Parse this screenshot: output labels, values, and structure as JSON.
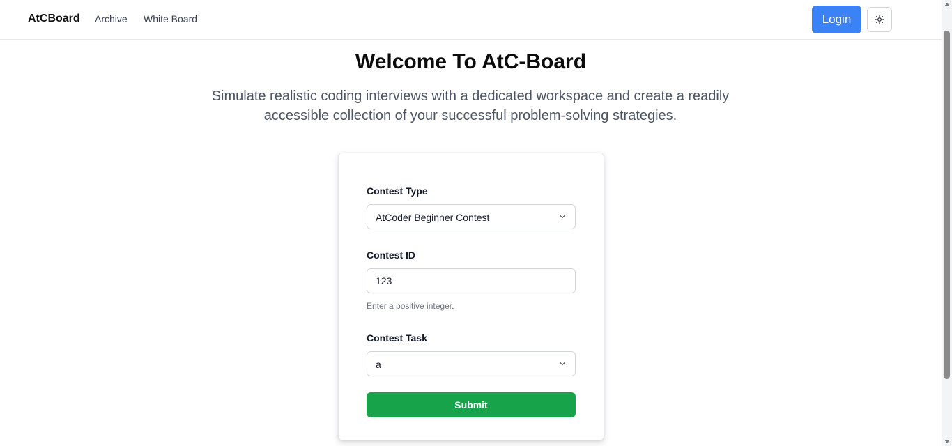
{
  "nav": {
    "brand": "AtCBoard",
    "links": [
      "Archive",
      "White Board"
    ],
    "login_label": "Login",
    "theme_icon": "sun-icon"
  },
  "hero": {
    "title": "Welcome To AtC-Board",
    "subtitle": "Simulate realistic coding interviews with a dedicated workspace and create a readily accessible collection of your successful problem-solving strategies."
  },
  "form": {
    "contest_type": {
      "label": "Contest Type",
      "value": "AtCoder Beginner Contest"
    },
    "contest_id": {
      "label": "Contest ID",
      "value": "123",
      "helper": "Enter a positive integer."
    },
    "contest_task": {
      "label": "Contest Task",
      "value": "a"
    },
    "submit_label": "Submit"
  },
  "colors": {
    "primary": "#3b82f6",
    "success": "#16a34a"
  }
}
